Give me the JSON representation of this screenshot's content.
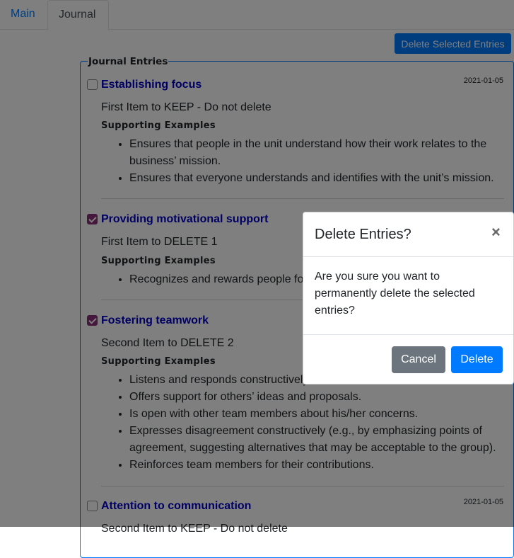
{
  "tabs": [
    {
      "label": "Main",
      "active": false
    },
    {
      "label": "Journal",
      "active": true
    }
  ],
  "toolbar": {
    "delete_selected_label": "Delete Selected Entries"
  },
  "journal": {
    "legend": "Journal Entries",
    "supporting_label": "Supporting Examples",
    "entries": [
      {
        "title": "Establishing focus",
        "date": "2021-01-05",
        "checked": false,
        "description": "First Item to KEEP - Do not delete",
        "examples": [
          "Ensures that people in the unit understand how their work relates to the business’ mission.",
          "Ensures that everyone understands and identifies with the unit’s mission."
        ]
      },
      {
        "title": "Providing motivational support",
        "date": "",
        "checked": true,
        "description": "First Item to DELETE 1",
        "examples": [
          "Recognizes and rewards people fo"
        ]
      },
      {
        "title": "Fostering teamwork",
        "date": "",
        "checked": true,
        "description": "Second Item to DELETE 2",
        "examples": [
          "Listens and responds constructively",
          "Offers support for others’ ideas and proposals.",
          "Is open with other team members about his/her concerns.",
          "Expresses disagreement constructively (e.g., by emphasizing points of agreement, suggesting alternatives that may be acceptable to the group).",
          "Reinforces team members for their contributions."
        ]
      },
      {
        "title": "Attention to communication",
        "date": "2021-01-05",
        "checked": false,
        "description": "Second Item to KEEP - Do not delete",
        "examples": []
      }
    ]
  },
  "modal": {
    "title": "Delete Entries?",
    "close_glyph": "×",
    "body": "Are you sure you want to permanently delete the selected entries?",
    "cancel_label": "Cancel",
    "delete_label": "Delete"
  },
  "colors": {
    "accent": "#007bff",
    "secondary": "#6c757d",
    "checkbox_checked": "#8b2f78",
    "entry_title": "#0000c8"
  }
}
